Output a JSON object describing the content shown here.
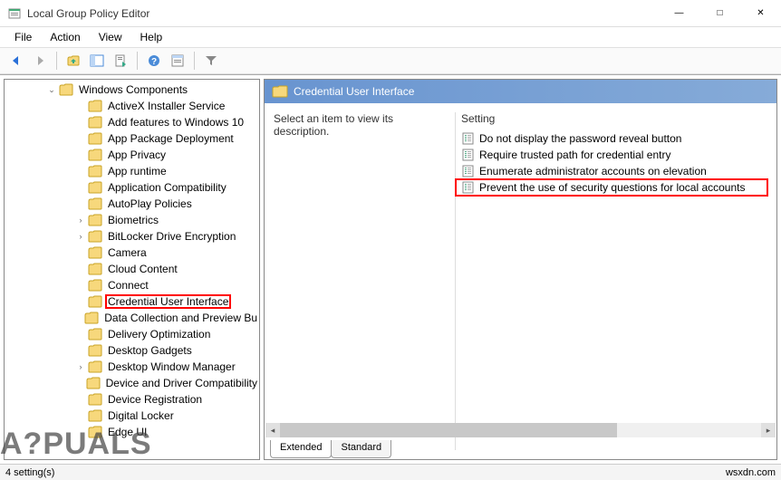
{
  "window": {
    "title": "Local Group Policy Editor"
  },
  "menubar": {
    "items": [
      "File",
      "Action",
      "View",
      "Help"
    ]
  },
  "tree": {
    "root": {
      "label": "Windows Components",
      "expanded": true
    },
    "children": [
      {
        "label": "ActiveX Installer Service",
        "expandable": false
      },
      {
        "label": "Add features to Windows 10",
        "expandable": false
      },
      {
        "label": "App Package Deployment",
        "expandable": false
      },
      {
        "label": "App Privacy",
        "expandable": false
      },
      {
        "label": "App runtime",
        "expandable": false
      },
      {
        "label": "Application Compatibility",
        "expandable": false
      },
      {
        "label": "AutoPlay Policies",
        "expandable": false
      },
      {
        "label": "Biometrics",
        "expandable": true
      },
      {
        "label": "BitLocker Drive Encryption",
        "expandable": true
      },
      {
        "label": "Camera",
        "expandable": false
      },
      {
        "label": "Cloud Content",
        "expandable": false
      },
      {
        "label": "Connect",
        "expandable": false
      },
      {
        "label": "Credential User Interface",
        "expandable": false,
        "highlighted": true
      },
      {
        "label": "Data Collection and Preview Bu",
        "expandable": false
      },
      {
        "label": "Delivery Optimization",
        "expandable": false
      },
      {
        "label": "Desktop Gadgets",
        "expandable": false
      },
      {
        "label": "Desktop Window Manager",
        "expandable": true
      },
      {
        "label": "Device and Driver Compatibility",
        "expandable": false
      },
      {
        "label": "Device Registration",
        "expandable": false
      },
      {
        "label": "Digital Locker",
        "expandable": false
      },
      {
        "label": "Edge UI",
        "expandable": false
      }
    ]
  },
  "right": {
    "header_title": "Credential User Interface",
    "description_prompt": "Select an item to view its description.",
    "column_header": "Setting",
    "settings": [
      {
        "label": "Do not display the password reveal button",
        "highlighted": false
      },
      {
        "label": "Require trusted path for credential entry",
        "highlighted": false
      },
      {
        "label": "Enumerate administrator accounts on elevation",
        "highlighted": false
      },
      {
        "label": "Prevent the use of security questions for local accounts",
        "highlighted": true
      }
    ],
    "tabs": [
      "Extended",
      "Standard"
    ],
    "active_tab": "Extended"
  },
  "statusbar": {
    "text": "4 setting(s)",
    "watermark": "wsxdn.com"
  },
  "logo_text": "A?PUALS"
}
